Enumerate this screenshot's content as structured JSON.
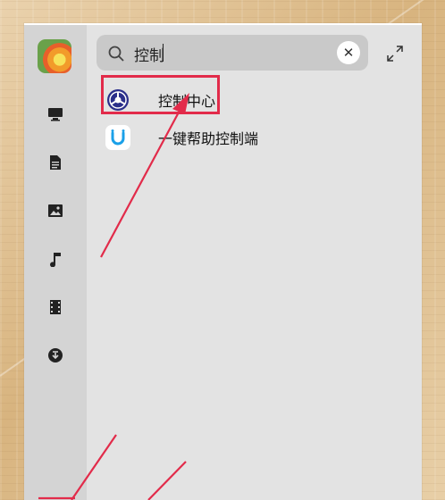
{
  "search": {
    "value": "控制",
    "clear_icon": "✕"
  },
  "results": [
    {
      "label": "控制中心",
      "icon": "control-center-icon"
    },
    {
      "label": "一键帮助控制端",
      "icon": "help-client-icon"
    }
  ],
  "sidebar": {
    "items": [
      {
        "name": "computer-icon"
      },
      {
        "name": "document-icon"
      },
      {
        "name": "picture-icon"
      },
      {
        "name": "music-icon"
      },
      {
        "name": "video-icon"
      },
      {
        "name": "download-icon"
      }
    ]
  },
  "colors": {
    "annotation": "#e22b4a",
    "window_bg": "#e3e3e3",
    "sidebar_bg": "#d4d4d4"
  }
}
